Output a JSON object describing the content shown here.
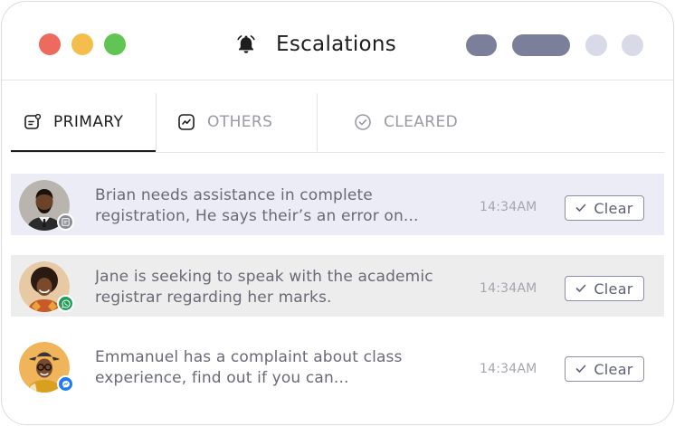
{
  "window": {
    "title": "Escalations",
    "title_icon": "bell-icon"
  },
  "tabs": [
    {
      "label": "PRIMARY",
      "icon": "inbox-icon",
      "active": true
    },
    {
      "label": "OTHERS",
      "icon": "activity-icon",
      "active": false
    },
    {
      "label": "CLEARED",
      "icon": "check-circle-icon",
      "active": false
    }
  ],
  "escalations": [
    {
      "line1": "Brian needs assistance in complete",
      "line2": "registration, He says their’s an error on...",
      "time": "14:34AM",
      "action": "Clear",
      "channel": "sms-icon"
    },
    {
      "line1": "Jane is seeking to speak with the academic",
      "line2": "registrar regarding her marks.",
      "time": "14:34AM",
      "action": "Clear",
      "channel": "whatsapp-icon"
    },
    {
      "line1": "Emmanuel has a complaint about class",
      "line2": "experience, find out if you can...",
      "time": "14:34AM",
      "action": "Clear",
      "channel": "messenger-icon"
    }
  ],
  "colors": {
    "accent": "#7b7f99",
    "row_highlight": "#ececf6",
    "whatsapp": "#1f9e57",
    "messenger": "#1f7bf2"
  }
}
